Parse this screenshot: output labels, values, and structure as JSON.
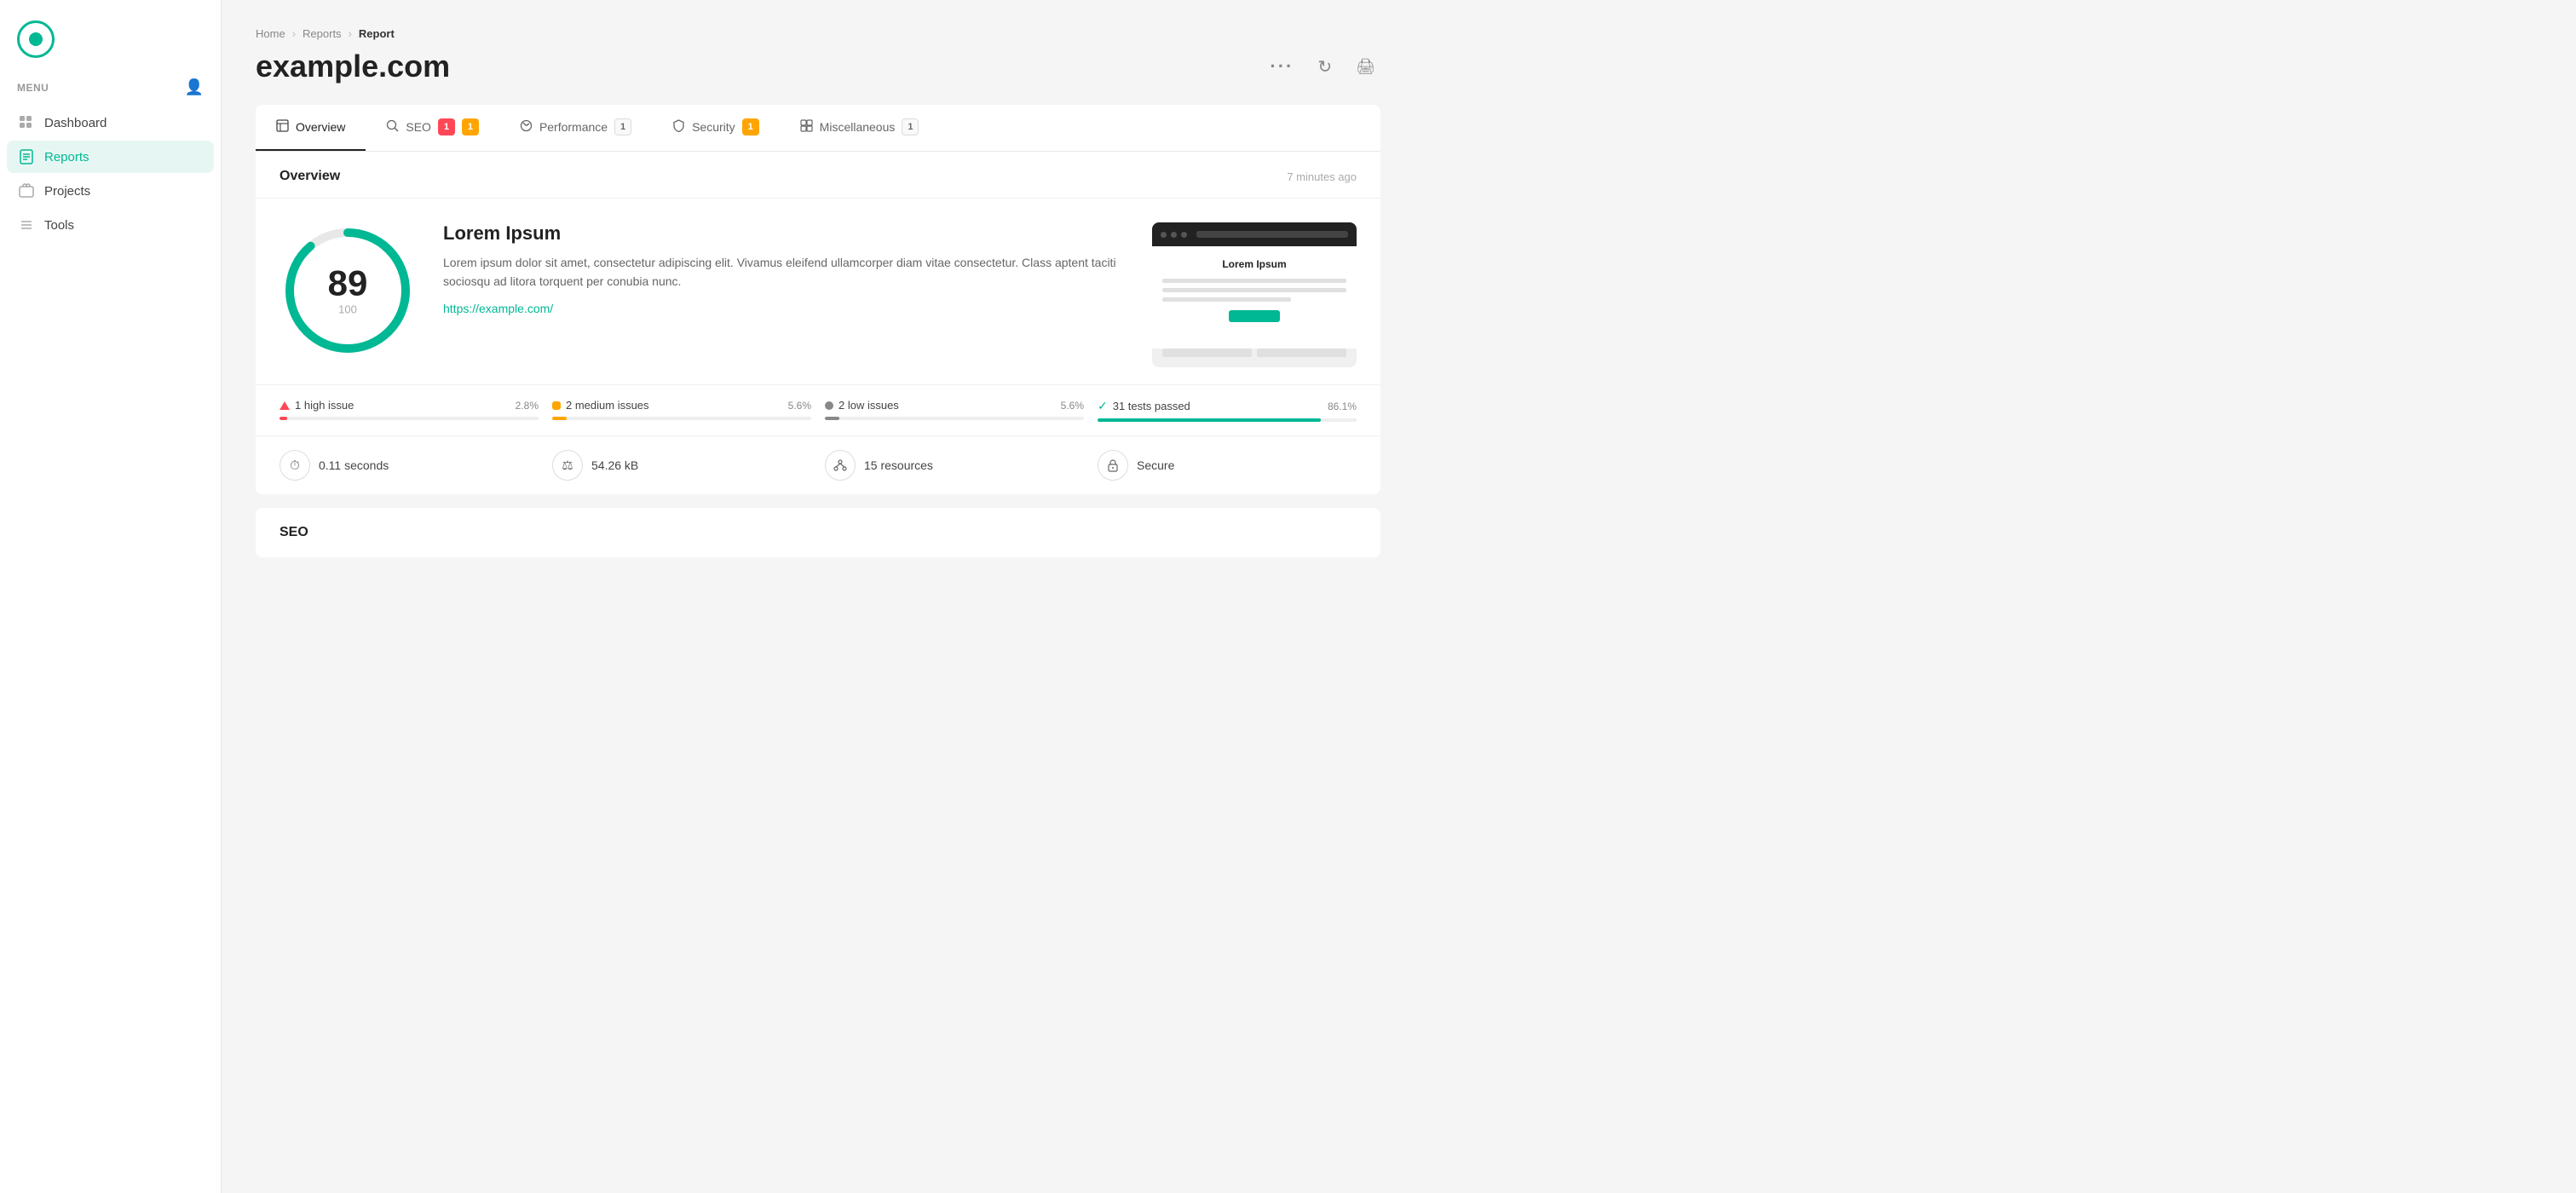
{
  "sidebar": {
    "menu_label": "MENU",
    "nav_items": [
      {
        "id": "dashboard",
        "label": "Dashboard",
        "active": false
      },
      {
        "id": "reports",
        "label": "Reports",
        "active": true
      },
      {
        "id": "projects",
        "label": "Projects",
        "active": false
      },
      {
        "id": "tools",
        "label": "Tools",
        "active": false
      }
    ]
  },
  "breadcrumb": {
    "home": "Home",
    "sep1": ">",
    "reports": "Reports",
    "sep2": ">",
    "current": "Report"
  },
  "page": {
    "title": "example.com"
  },
  "header_actions": {
    "more": "...",
    "refresh": "↻",
    "print": "🖨"
  },
  "tabs": [
    {
      "id": "overview",
      "label": "Overview",
      "active": true,
      "badges": []
    },
    {
      "id": "seo",
      "label": "SEO",
      "active": false,
      "badges": [
        {
          "value": "1",
          "type": "red"
        },
        {
          "value": "1",
          "type": "yellow"
        }
      ]
    },
    {
      "id": "performance",
      "label": "Performance",
      "active": false,
      "badges": [
        {
          "value": "1",
          "type": "outline"
        }
      ]
    },
    {
      "id": "security",
      "label": "Security",
      "active": false,
      "badges": [
        {
          "value": "1",
          "type": "yellow"
        }
      ]
    },
    {
      "id": "miscellaneous",
      "label": "Miscellaneous",
      "active": false,
      "badges": [
        {
          "value": "1",
          "type": "outline"
        }
      ]
    }
  ],
  "overview": {
    "title": "Overview",
    "timestamp": "7 minutes ago",
    "score": {
      "value": "89",
      "total": "100",
      "percent": 89,
      "color": "#00b894",
      "track_color": "#e0e0e0"
    },
    "report": {
      "name": "Lorem Ipsum",
      "description": "Lorem ipsum dolor sit amet, consectetur adipiscing elit. Vivamus eleifend ullamcorper diam vitae consectetur. Class aptent taciti sociosqu ad litora torquent per conubia nunc.",
      "url": "https://example.com/"
    },
    "preview": {
      "title": "Lorem Ipsum",
      "button_label": ""
    },
    "issues": [
      {
        "id": "high",
        "icon": "triangle",
        "label": "1 high issue",
        "pct": "2.8%",
        "fill_pct": 2.8,
        "color": "#ff4757"
      },
      {
        "id": "medium",
        "icon": "square",
        "label": "2 medium issues",
        "pct": "5.6%",
        "fill_pct": 5.6,
        "color": "#ffa502"
      },
      {
        "id": "low",
        "icon": "circle",
        "label": "2 low issues",
        "pct": "5.6%",
        "fill_pct": 5.6,
        "color": "#888888"
      },
      {
        "id": "passed",
        "icon": "check",
        "label": "31 tests passed",
        "pct": "86.1%",
        "fill_pct": 86.1,
        "color": "#00b894"
      }
    ],
    "stats": [
      {
        "id": "time",
        "icon": "⏱",
        "label": "0.11 seconds"
      },
      {
        "id": "size",
        "icon": "⚖",
        "label": "54.26 kB"
      },
      {
        "id": "resources",
        "icon": "🔗",
        "label": "15 resources"
      },
      {
        "id": "secure",
        "icon": "🔒",
        "label": "Secure"
      }
    ]
  },
  "seo_section": {
    "title": "SEO"
  }
}
